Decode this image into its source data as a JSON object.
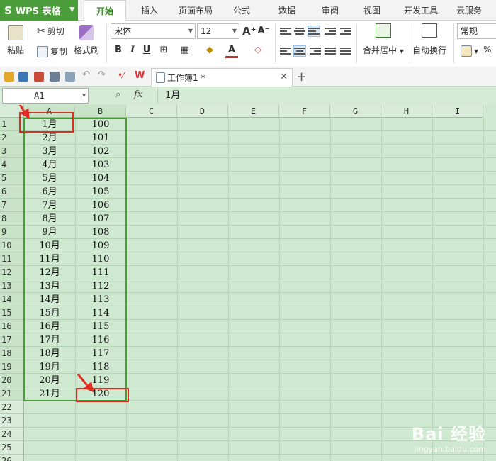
{
  "app": {
    "name": "WPS 表格",
    "logo": "S"
  },
  "menu_tabs": [
    {
      "label": "开始",
      "active": true
    },
    {
      "label": "插入"
    },
    {
      "label": "页面布局"
    },
    {
      "label": "公式"
    },
    {
      "label": "数据"
    },
    {
      "label": "审阅"
    },
    {
      "label": "视图"
    },
    {
      "label": "开发工具"
    },
    {
      "label": "云服务"
    }
  ],
  "ribbon": {
    "paste_label": "粘贴",
    "cut_label": "剪切",
    "copy_label": "复制",
    "format_painter_label": "格式刷",
    "font_name": "宋体",
    "font_size": "12",
    "bold": "B",
    "italic": "I",
    "underline": "U",
    "merge_center_label": "合并居中",
    "wrap_text_label": "自动换行",
    "number_format": "常规",
    "percent": "%"
  },
  "document_tab": {
    "title": "工作簿1 *"
  },
  "formula_bar": {
    "name_box": "A1",
    "fx": "fx",
    "value": "1月"
  },
  "columns": [
    "A",
    "B",
    "C",
    "D",
    "E",
    "F",
    "G",
    "H",
    "I"
  ],
  "rows": [
    "1",
    "2",
    "3",
    "4",
    "5",
    "6",
    "7",
    "8",
    "9",
    "10",
    "11",
    "12",
    "13",
    "14",
    "15",
    "16",
    "17",
    "18",
    "19",
    "20",
    "21",
    "22",
    "23",
    "24",
    "25",
    "26"
  ],
  "cells": [
    [
      "1月",
      "100"
    ],
    [
      "2月",
      "101"
    ],
    [
      "3月",
      "102"
    ],
    [
      "4月",
      "103"
    ],
    [
      "5月",
      "104"
    ],
    [
      "6月",
      "105"
    ],
    [
      "7月",
      "106"
    ],
    [
      "8月",
      "107"
    ],
    [
      "9月",
      "108"
    ],
    [
      "10月",
      "109"
    ],
    [
      "11月",
      "110"
    ],
    [
      "12月",
      "111"
    ],
    [
      "13月",
      "112"
    ],
    [
      "14月",
      "113"
    ],
    [
      "15月",
      "114"
    ],
    [
      "16月",
      "115"
    ],
    [
      "17月",
      "116"
    ],
    [
      "18月",
      "117"
    ],
    [
      "19月",
      "118"
    ],
    [
      "20月",
      "119"
    ],
    [
      "21月",
      "120"
    ]
  ],
  "watermark": {
    "brand": "Bai 经验",
    "url": "jingyan.baidu.com"
  },
  "colors": {
    "accent": "#4b9c3a",
    "sheet_bg": "#cfe8d0",
    "annotation": "#e02b20"
  }
}
